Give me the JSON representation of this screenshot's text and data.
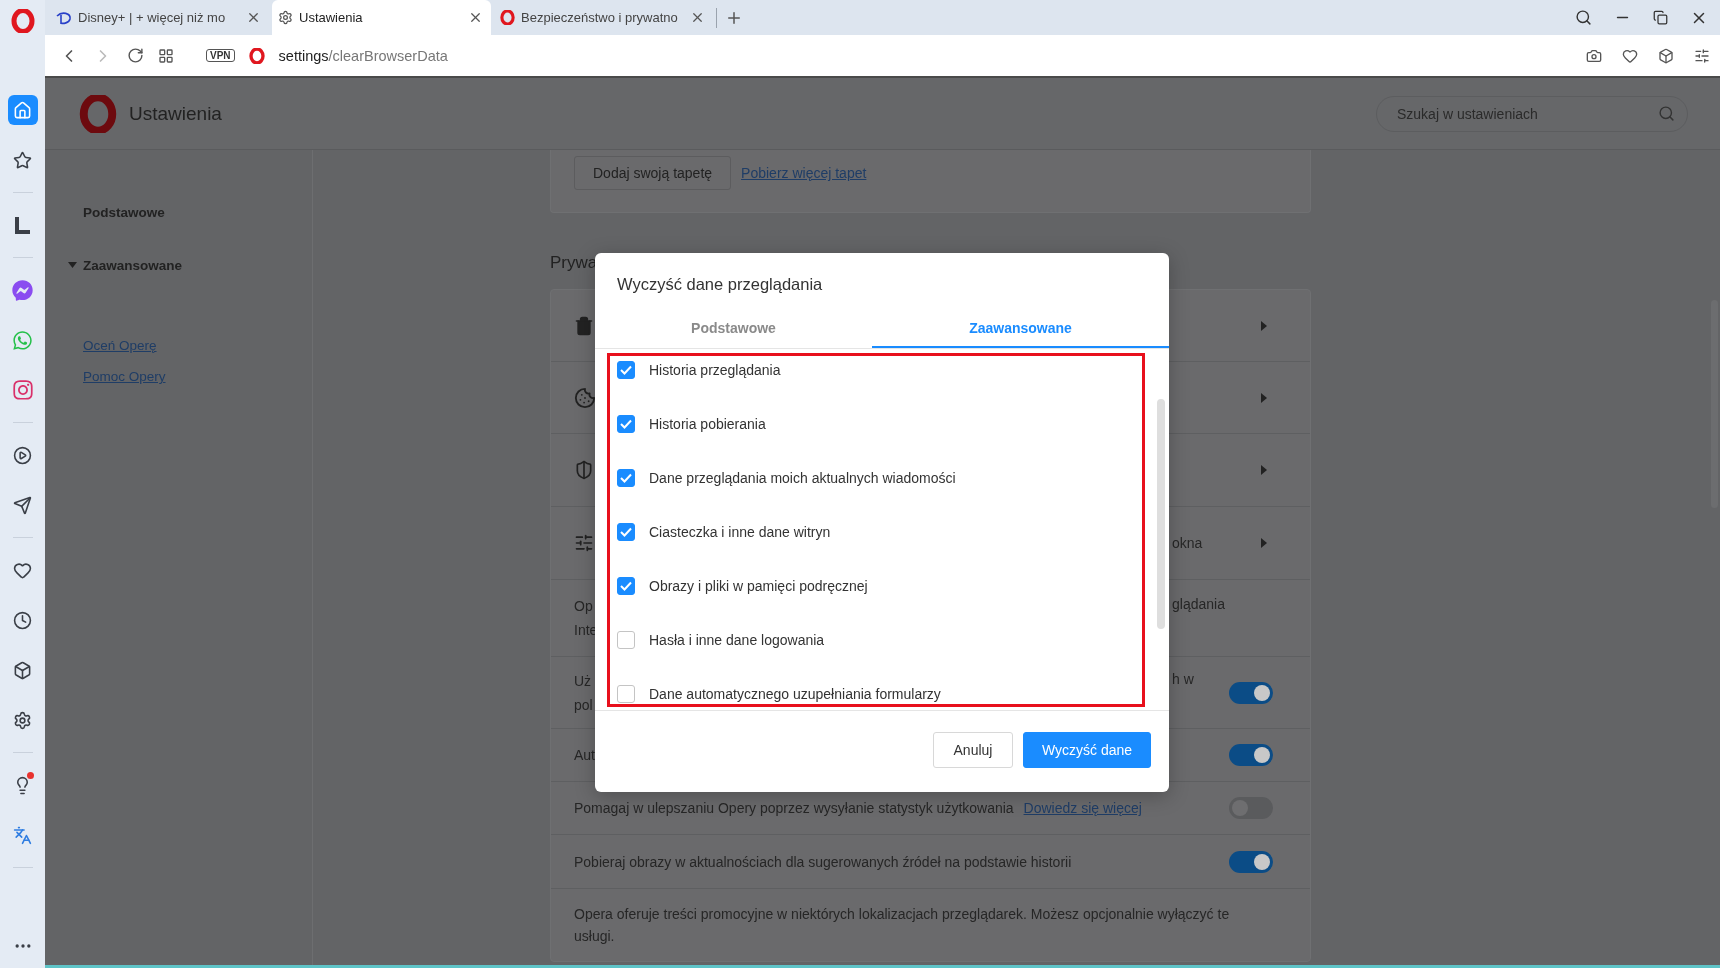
{
  "browser_tabs": [
    {
      "title": "Disney+ | + więcej niż mo",
      "kind": "disney",
      "selected": false
    },
    {
      "title": "Ustawienia",
      "kind": "settings",
      "selected": true
    },
    {
      "title": "Bezpieczeństwo i prywatno",
      "kind": "opera",
      "selected": false
    }
  ],
  "toolbar": {
    "vpn_badge": "VPN",
    "url_host": "settings",
    "url_path": "/clearBrowserData"
  },
  "sidebar": {
    "groups": [
      [
        {
          "kind": "home",
          "selected": true,
          "notification": false
        },
        {
          "kind": "star",
          "selected": false,
          "notification": false
        }
      ],
      [
        {
          "kind": "corner",
          "selected": false,
          "notification": false
        }
      ],
      [
        {
          "kind": "messenger",
          "selected": false,
          "notification": false
        },
        {
          "kind": "whatsapp",
          "selected": false,
          "notification": false
        },
        {
          "kind": "instagram",
          "selected": false,
          "notification": false
        }
      ],
      [
        {
          "kind": "player",
          "selected": false,
          "notification": false
        },
        {
          "kind": "send",
          "selected": false,
          "notification": false
        }
      ],
      [
        {
          "kind": "heart",
          "selected": false,
          "notification": false
        },
        {
          "kind": "clock",
          "selected": false,
          "notification": false
        },
        {
          "kind": "cube",
          "selected": false,
          "notification": false
        },
        {
          "kind": "gear",
          "selected": false,
          "notification": false
        }
      ],
      [
        {
          "kind": "bulb",
          "selected": false,
          "notification": true
        },
        {
          "kind": "translate",
          "selected": false,
          "notification": false
        }
      ]
    ]
  },
  "settings": {
    "title": "Ustawienia",
    "search": {
      "placeholder": "Szukaj w ustawieniach"
    },
    "nav": [
      {
        "label": "Podstawowe",
        "kind": "page"
      },
      {
        "label": "Zaawansowane",
        "kind": "group",
        "expanded": true
      }
    ],
    "nav_links": [
      "Oceń Operę",
      "Pomoc Opery"
    ]
  },
  "content": {
    "wallpaper": {
      "button": "Dodaj swoją tapetę",
      "link": "Pobierz więcej tapet"
    },
    "section_heading": "Prywa",
    "rows": [
      {
        "kind": "nav"
      },
      {
        "kind": "nav"
      },
      {
        "kind": "nav"
      },
      {
        "kind": "nav",
        "end": "okna"
      },
      {
        "kind": "text",
        "start": [
          "Op",
          "Inte"
        ],
        "end": "glądania"
      },
      {
        "kind": "toggle",
        "start": [
          "Uż",
          "pol"
        ],
        "end": "h w",
        "on": true
      },
      {
        "kind": "toggle",
        "start": [
          "Aut"
        ],
        "on": true
      },
      {
        "kind": "toggle",
        "start": [
          "Pomagaj w ulepszaniu Opery poprzez wysyłanie statystyk użytkowania"
        ],
        "link": "Dowiedz się więcej",
        "on": false
      },
      {
        "kind": "toggle",
        "start": [
          "Pobieraj obrazy w aktualnościach dla sugerowanych źródeł na podstawie historii"
        ],
        "on": true
      }
    ],
    "promo": "Opera oferuje treści promocyjne w niektórych lokalizacjach przeglądarek. Możesz opcjonalnie wyłączyć te usługi."
  },
  "dialog": {
    "title": "Wyczyść dane przeglądania",
    "tabs": [
      {
        "label": "Podstawowe",
        "selected": false
      },
      {
        "label": "Zaawansowane",
        "selected": true
      }
    ],
    "items": [
      {
        "label": "Historia przeglądania",
        "checked": true
      },
      {
        "label": "Historia pobierania",
        "checked": true
      },
      {
        "label": "Dane przeglądania moich aktualnych wiadomości",
        "checked": true
      },
      {
        "label": "Ciasteczka i inne dane witryn",
        "checked": true
      },
      {
        "label": "Obrazy i pliki w pamięci podręcznej",
        "checked": true
      },
      {
        "label": "Hasła i inne dane logowania",
        "checked": false
      },
      {
        "label": "Dane automatycznego uzupełniania formularzy",
        "checked": false
      }
    ],
    "buttons": [
      {
        "label": "Anuluj",
        "kind": "secondary"
      },
      {
        "label": "Wyczyść dane",
        "kind": "primary"
      }
    ]
  }
}
